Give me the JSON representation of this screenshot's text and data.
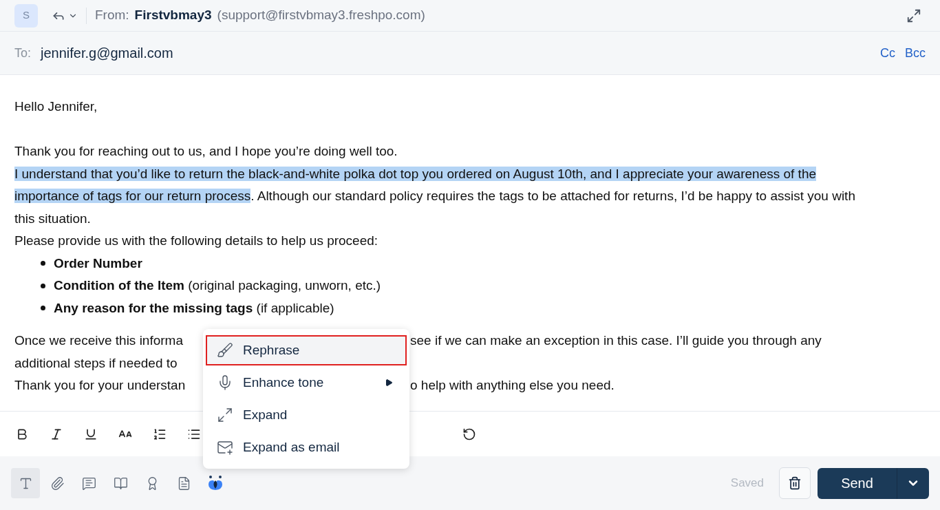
{
  "header": {
    "avatar": "S",
    "from_label": "From:",
    "from_name": "Firstvbmay3",
    "from_email": "(support@firstvbmay3.freshpo.com)",
    "to_label": "To:",
    "to_value": "jennifer.g@gmail.com",
    "cc": "Cc",
    "bcc": "Bcc"
  },
  "body": {
    "greeting": "Hello Jennifer,",
    "intro": "Thank you for reaching out to us, and I hope you’re doing well too.",
    "paragraph": [
      {
        "text": "I understand that you’d like to return the black-and-white polka dot top you ordered on August 10th, and I appreciate your awareness of the importance of tags for our return process",
        "highlighted": true
      },
      {
        "text": ". Although our standard policy requires the tags to be attached for returns, I’d be happy to assist you with this situation.",
        "highlighted": false
      }
    ],
    "request": "Please provide us with the following details to help us proceed:",
    "bullets": [
      "**Order Number**",
      "**Condition of the Item** (original packaging, unworn, etc.)",
      "**Any reason for the missing tags** (if applicable)"
    ],
    "covered_lines": [
      {
        "left": "Once we receive this informa",
        "right": "see if we can make an exception in this case. I’ll guide you through any"
      },
      {
        "left": "additional steps if needed to"
      },
      {
        "left": "Thank you for your understan",
        "right": "o help with anything else you need."
      }
    ]
  },
  "format_tools": [
    {
      "kind": "bold"
    },
    {
      "kind": "italic"
    },
    {
      "kind": "underline"
    },
    {
      "kind": "font-size"
    },
    {
      "kind": "numbered-list"
    },
    {
      "kind": "bullet-list"
    }
  ],
  "format_tools_right": [
    {
      "kind": "circle-a"
    }
  ],
  "bottom_tools": [
    {
      "kind": "text",
      "selected": true
    },
    {
      "kind": "attach",
      "selected": false
    },
    {
      "kind": "star-message",
      "selected": false
    },
    {
      "kind": "book",
      "selected": false
    },
    {
      "kind": "award",
      "selected": false
    },
    {
      "kind": "doc-star",
      "selected": false
    },
    {
      "kind": "ai",
      "selected": false
    }
  ],
  "ai_menu": [
    {
      "kind": "rephrase",
      "label": "Rephrase",
      "selected": true,
      "submenu": false
    },
    {
      "kind": "tone",
      "label": "Enhance tone",
      "selected": false,
      "submenu": true
    },
    {
      "kind": "expand",
      "label": "Expand",
      "selected": false,
      "submenu": false
    },
    {
      "kind": "email",
      "label": "Expand as email",
      "selected": false,
      "submenu": false
    }
  ],
  "footer": {
    "status": "Saved",
    "send": "Send"
  }
}
